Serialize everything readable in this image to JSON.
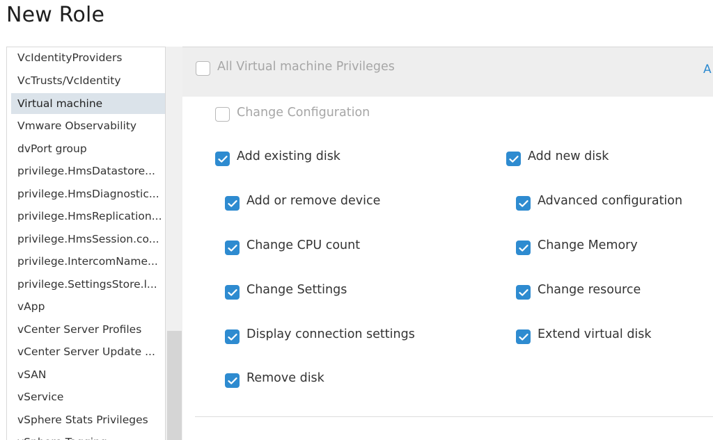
{
  "page": {
    "title": "New Role"
  },
  "sidebar": {
    "items": [
      "VcIdentityProviders",
      "VcTrusts/VcIdentity",
      "Virtual machine",
      "Vmware Observability",
      "dvPort group",
      "privilege.HmsDatastore...",
      "privilege.HmsDiagnostic...",
      "privilege.HmsReplication...",
      "privilege.HmsSession.co...",
      "privilege.IntercomName...",
      "privilege.SettingsStore.l...",
      "vApp",
      "vCenter Server Profiles",
      "vCenter Server Update ...",
      "vSAN",
      "vService",
      "vSphere Stats Privileges",
      "vSphere Tagging"
    ],
    "selected": "Virtual machine"
  },
  "privileges": {
    "all_label": "All Virtual machine Privileges",
    "all_checked": false,
    "header_link": "A",
    "group_label": "Change Configuration",
    "group_checked": false,
    "items": [
      {
        "label": "Add existing disk",
        "checked": true
      },
      {
        "label": "Add new disk",
        "checked": true
      },
      {
        "label": "Add or remove device",
        "checked": true
      },
      {
        "label": "Advanced configuration",
        "checked": true
      },
      {
        "label": "Change CPU count",
        "checked": true
      },
      {
        "label": "Change Memory",
        "checked": true
      },
      {
        "label": "Change Settings",
        "checked": true
      },
      {
        "label": "Change resource",
        "checked": true
      },
      {
        "label": "Display connection settings",
        "checked": true
      },
      {
        "label": "Extend virtual disk",
        "checked": true
      },
      {
        "label": "Remove disk",
        "checked": true
      }
    ]
  },
  "colors": {
    "accent": "#2e8bd0",
    "selected_bg": "#dbe3ea"
  }
}
